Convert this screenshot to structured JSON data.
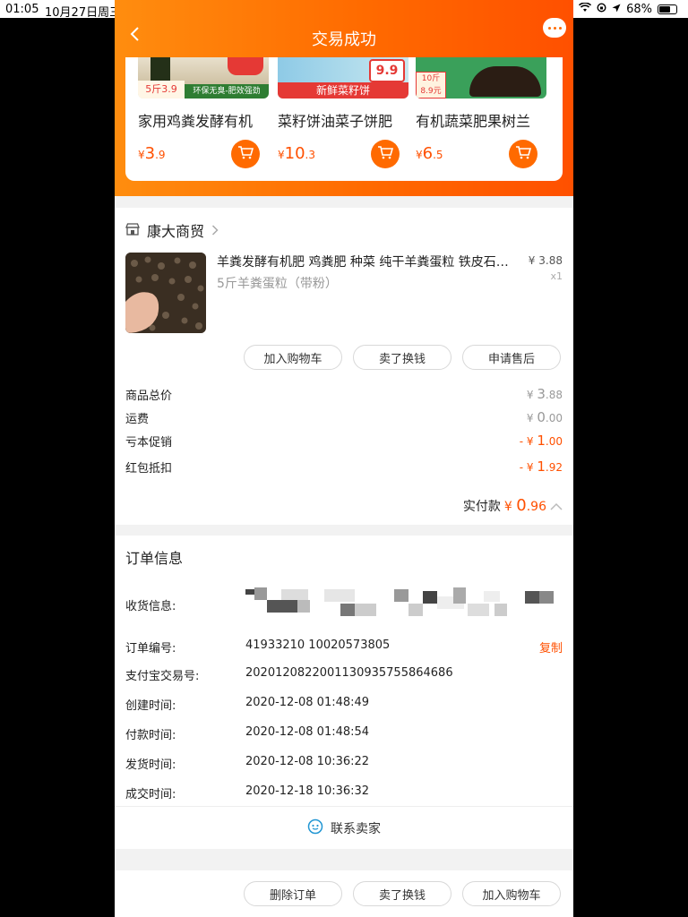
{
  "status_bar": {
    "time": "01:05",
    "date": "10月27日周三",
    "battery": "68%",
    "battery_level": 0.68
  },
  "nav": {
    "back_icon": "chevron-left-icon",
    "title": "交易成功",
    "more_icon": "more-icon"
  },
  "recommend": [
    {
      "name": "家用鸡粪发酵有机",
      "price_symbol": "¥",
      "price_int": "3",
      "price_dec": ".9",
      "banner": "环保无臭-肥效强劲",
      "badge": "5斤3.9"
    },
    {
      "name": "菜籽饼油菜子饼肥",
      "price_symbol": "¥",
      "price_int": "10",
      "price_dec": ".3",
      "banner": "新鲜菜籽饼",
      "badge": "9.9"
    },
    {
      "name": "有机蔬菜肥果树兰",
      "price_symbol": "¥",
      "price_int": "6",
      "price_dec": ".5",
      "banner": "",
      "badge": "10斤 8.9元"
    }
  ],
  "shop": {
    "name": "康大商贸",
    "item": {
      "title": "羊粪发酵有机肥 鸡粪肥 种菜 纯干羊粪蛋粒 铁皮石…",
      "sku": "5斤羊粪蛋粒（带粉）",
      "price_symbol": "¥",
      "price_int": "3",
      "price_dec": ".88",
      "qty": "x1"
    },
    "actions": [
      "加入购物车",
      "卖了换钱",
      "申请售后"
    ],
    "fees": [
      {
        "label": "商品总价",
        "prefix": "¥ ",
        "int": "3",
        "dec": ".88",
        "red": false
      },
      {
        "label": "运费",
        "prefix": "¥ ",
        "int": "0",
        "dec": ".00",
        "red": false
      },
      {
        "label": "亏本促销",
        "prefix": "- ¥ ",
        "int": "1",
        "dec": ".00",
        "red": true
      },
      {
        "label": "红包抵扣",
        "prefix": "- ¥ ",
        "int": "1",
        "dec": ".92",
        "red": true
      }
    ],
    "paid_label": "实付款",
    "paid_symbol": "¥",
    "paid_int": "0",
    "paid_dec": ".96"
  },
  "order_info": {
    "title": "订单信息",
    "address_label": "收货信息:",
    "rows": [
      {
        "label": "订单编号:",
        "value": "41933210 10020573805",
        "copy": "复制"
      },
      {
        "label": "支付宝交易号:",
        "value": "2020120822001130935755864686"
      },
      {
        "label": "创建时间:",
        "value": "2020-12-08 01:48:49"
      },
      {
        "label": "付款时间:",
        "value": "2020-12-08 01:48:54"
      },
      {
        "label": "发货时间:",
        "value": "2020-12-08 10:36:22"
      },
      {
        "label": "成交时间:",
        "value": "2020-12-18 10:36:32"
      }
    ],
    "contact": "联系卖家"
  },
  "bottom_actions": [
    "删除订单",
    "卖了换钱",
    "加入购物车"
  ],
  "colors": {
    "accent": "#ff5000",
    "header_start": "#ff8d0f",
    "header_end": "#ff5000"
  }
}
